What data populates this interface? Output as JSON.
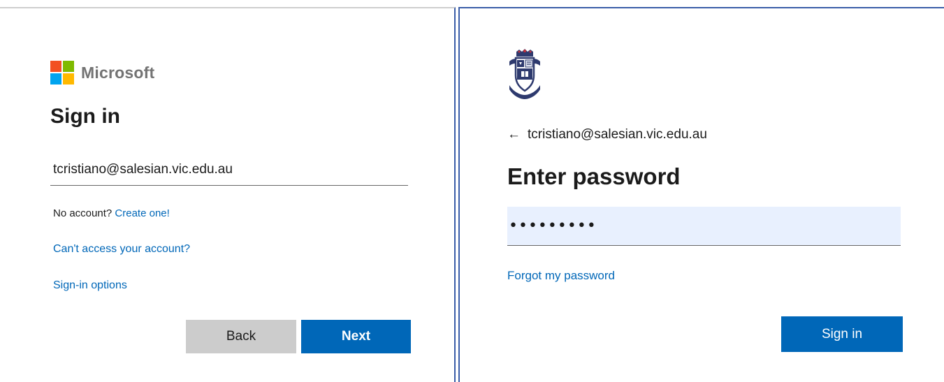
{
  "left": {
    "brand": "Microsoft",
    "title": "Sign in",
    "email_value": "tcristiano@salesian.vic.edu.au",
    "no_account_text": "No account?",
    "create_link": "Create one!",
    "cant_access_link": "Can't access your account?",
    "signin_options_link": "Sign-in options",
    "back_label": "Back",
    "next_label": "Next"
  },
  "right": {
    "back_arrow": "←",
    "email": "tcristiano@salesian.vic.edu.au",
    "title": "Enter password",
    "password_masked": "•••••••••",
    "forgot_link": "Forgot my password",
    "signin_label": "Sign in"
  },
  "colors": {
    "accent": "#0067b8",
    "back_button": "#cccccc",
    "password_bg": "#e8f0fe",
    "panel_border": "#3a5da8"
  },
  "icons": {
    "logo_left": "microsoft-logo",
    "logo_right": "school-crest-logo",
    "back": "arrow-left-icon"
  }
}
